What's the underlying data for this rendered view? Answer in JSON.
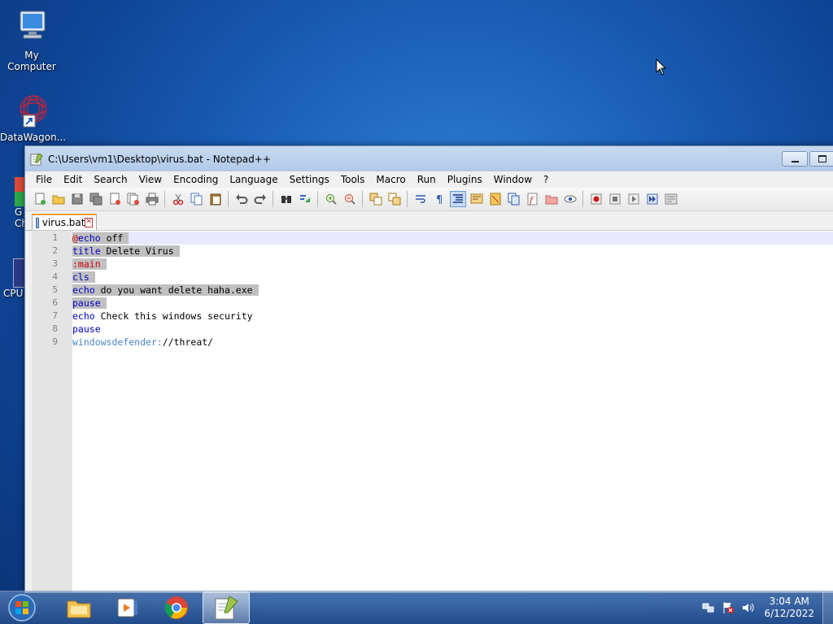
{
  "desktop": {
    "icons": [
      {
        "label": "My Computer"
      },
      {
        "label": "DataWagon..."
      }
    ],
    "partial_icons": [
      {
        "label": "G\nCh"
      },
      {
        "label": "CPU"
      }
    ]
  },
  "window": {
    "title": "C:\\Users\\vm1\\Desktop\\virus.bat - Notepad++",
    "menu": [
      "File",
      "Edit",
      "Search",
      "View",
      "Encoding",
      "Language",
      "Settings",
      "Tools",
      "Macro",
      "Run",
      "Plugins",
      "Window",
      "?"
    ],
    "tab": {
      "label": "virus.bat"
    },
    "lines": [
      {
        "num": "1",
        "segments": [
          {
            "t": "@",
            "c": "at"
          },
          {
            "t": "echo",
            "c": "kw"
          },
          {
            "t": " off",
            "c": ""
          }
        ],
        "selected_until": 9,
        "current": true
      },
      {
        "num": "2",
        "segments": [
          {
            "t": "title",
            "c": "kw"
          },
          {
            "t": " Delete Virus",
            "c": ""
          }
        ],
        "selected": true
      },
      {
        "num": "3",
        "segments": [
          {
            "t": ":main",
            "c": "lbl"
          }
        ],
        "selected": true
      },
      {
        "num": "4",
        "segments": [
          {
            "t": "cls",
            "c": "kw"
          }
        ],
        "selected": true
      },
      {
        "num": "5",
        "segments": [
          {
            "t": "echo",
            "c": "kw"
          },
          {
            "t": " do you want delete haha.exe",
            "c": ""
          }
        ],
        "selected": true
      },
      {
        "num": "6",
        "segments": [
          {
            "t": "pause",
            "c": "kw"
          }
        ],
        "selected": true
      },
      {
        "num": "7",
        "segments": [
          {
            "t": "echo",
            "c": "kw"
          },
          {
            "t": " Check this windows security",
            "c": ""
          }
        ]
      },
      {
        "num": "8",
        "segments": [
          {
            "t": "pause",
            "c": "kw"
          }
        ]
      },
      {
        "num": "9",
        "segments": [
          {
            "t": "windowsdefender:",
            "c": "url"
          },
          {
            "t": "//threat/",
            "c": ""
          }
        ]
      }
    ]
  },
  "taskbar": {
    "clock_time": "3:04 AM",
    "clock_date": "6/12/2022"
  },
  "colors": {
    "keyword": "#0000c0",
    "label": "#d00000",
    "selection": "#c0c0c0",
    "tab_accent": "#f39b33"
  }
}
